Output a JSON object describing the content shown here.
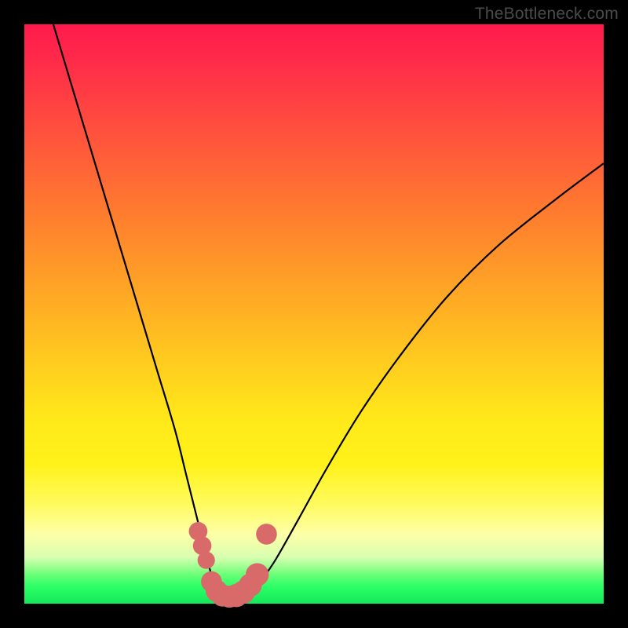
{
  "watermark": "TheBottleneck.com",
  "chart_data": {
    "type": "line",
    "title": "",
    "xlabel": "",
    "ylabel": "",
    "xlim": [
      0,
      100
    ],
    "ylim": [
      0,
      100
    ],
    "grid": false,
    "legend": false,
    "series": [
      {
        "name": "bottleneck-curve",
        "color": "#000000",
        "x": [
          5,
          8,
          11,
          14,
          17,
          20,
          23,
          26,
          28,
          30,
          31,
          32,
          33,
          34,
          35,
          36,
          38,
          40,
          43,
          47,
          52,
          58,
          65,
          73,
          82,
          92,
          100
        ],
        "y": [
          100,
          90,
          80,
          70,
          60,
          50,
          40,
          30,
          22,
          14,
          10,
          6,
          3,
          1.5,
          1,
          1,
          1.5,
          3,
          7,
          14,
          23,
          33,
          43,
          53,
          62,
          70,
          76
        ]
      }
    ],
    "markers": [
      {
        "name": "dot-a",
        "x": 30.0,
        "y": 12.5,
        "color": "#d96a6a",
        "r": 1.6
      },
      {
        "name": "dot-b",
        "x": 30.7,
        "y": 10.0,
        "color": "#d96a6a",
        "r": 1.6
      },
      {
        "name": "dot-c",
        "x": 31.4,
        "y": 7.5,
        "color": "#d96a6a",
        "r": 1.5
      },
      {
        "name": "dot-d",
        "x": 32.3,
        "y": 3.8,
        "color": "#d96a6a",
        "r": 1.8
      },
      {
        "name": "dot-e",
        "x": 33.2,
        "y": 2.2,
        "color": "#d96a6a",
        "r": 1.9
      },
      {
        "name": "dot-f",
        "x": 34.2,
        "y": 1.4,
        "color": "#d96a6a",
        "r": 1.9
      },
      {
        "name": "dot-g",
        "x": 35.4,
        "y": 1.2,
        "color": "#d96a6a",
        "r": 1.9
      },
      {
        "name": "dot-h",
        "x": 36.6,
        "y": 1.4,
        "color": "#d96a6a",
        "r": 2.0
      },
      {
        "name": "dot-i",
        "x": 37.8,
        "y": 2.0,
        "color": "#d96a6a",
        "r": 2.0
      },
      {
        "name": "dot-j",
        "x": 39.0,
        "y": 3.2,
        "color": "#d96a6a",
        "r": 2.0
      },
      {
        "name": "dot-k",
        "x": 40.2,
        "y": 5.0,
        "color": "#d96a6a",
        "r": 2.0
      },
      {
        "name": "dot-l",
        "x": 41.8,
        "y": 12.0,
        "color": "#d96a6a",
        "r": 1.8
      }
    ],
    "gradient_bands": [
      {
        "y": 100,
        "color": "#ff1a4d"
      },
      {
        "y": 70,
        "color": "#ff7a2f"
      },
      {
        "y": 45,
        "color": "#ffc81f"
      },
      {
        "y": 25,
        "color": "#fff21a"
      },
      {
        "y": 12,
        "color": "#fdffa8"
      },
      {
        "y": 4,
        "color": "#6bff78"
      },
      {
        "y": 0,
        "color": "#14e85a"
      }
    ]
  }
}
